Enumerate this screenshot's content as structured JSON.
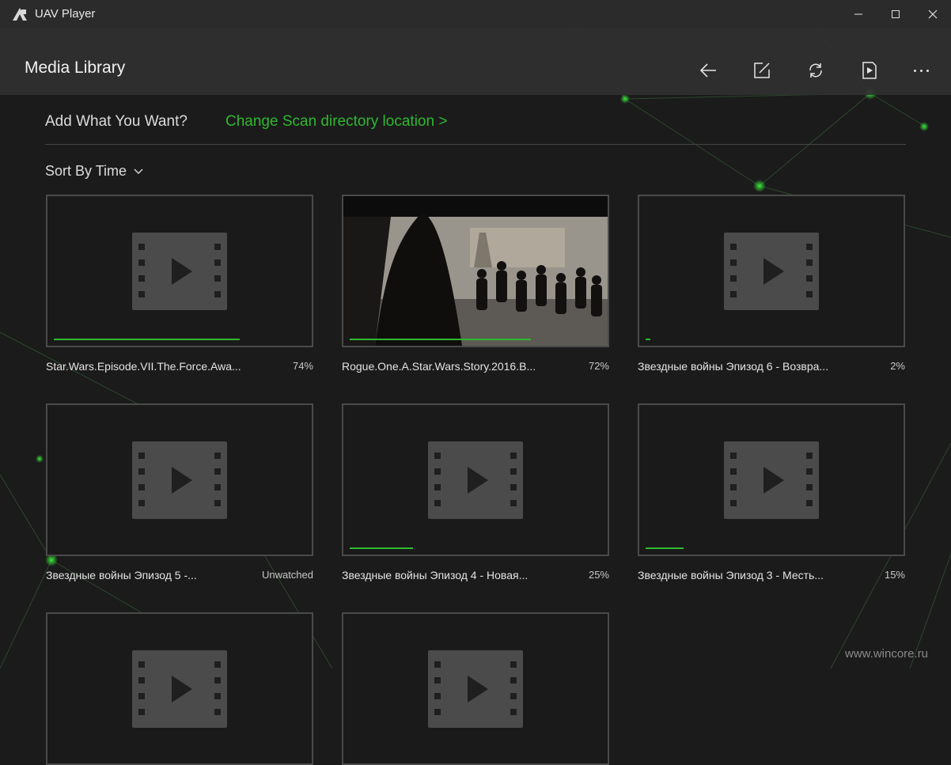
{
  "window": {
    "title": "UAV Player"
  },
  "header": {
    "title": "Media Library"
  },
  "toolbar": {
    "icons": [
      "back-arrow-icon",
      "edit-icon",
      "refresh-icon",
      "play-file-icon",
      "more-icon"
    ]
  },
  "scan": {
    "label": "Add What You Want?",
    "link": "Change Scan directory location >"
  },
  "sort": {
    "label": "Sort By Time"
  },
  "colors": {
    "accent": "#2dba2d",
    "background": "#1b1b1b",
    "header": "#303030"
  },
  "media": [
    {
      "name": "Star.Wars.Episode.VII.The.Force.Awa...",
      "status": "74%",
      "progress": 0.74,
      "thumbnail": "placeholder"
    },
    {
      "name": "Rogue.One.A.Star.Wars.Story.2016.B...",
      "status": "72%",
      "progress": 0.72,
      "thumbnail": "image"
    },
    {
      "name": "Звездные войны Эпизод 6 - Возвра...",
      "status": "2%",
      "progress": 0.02,
      "thumbnail": "placeholder"
    },
    {
      "name": "Звездные войны Эпизод 5 -...",
      "status": "Unwatched",
      "progress": 0,
      "thumbnail": "placeholder"
    },
    {
      "name": "Звездные войны Эпизод 4 - Новая...",
      "status": "25%",
      "progress": 0.25,
      "thumbnail": "placeholder"
    },
    {
      "name": "Звездные войны Эпизод 3 - Месть...",
      "status": "15%",
      "progress": 0.15,
      "thumbnail": "placeholder"
    },
    {
      "name": "",
      "status": "",
      "progress": 0,
      "thumbnail": "placeholder"
    },
    {
      "name": "",
      "status": "",
      "progress": 0,
      "thumbnail": "placeholder"
    }
  ],
  "watermark": "www.wincore.ru"
}
